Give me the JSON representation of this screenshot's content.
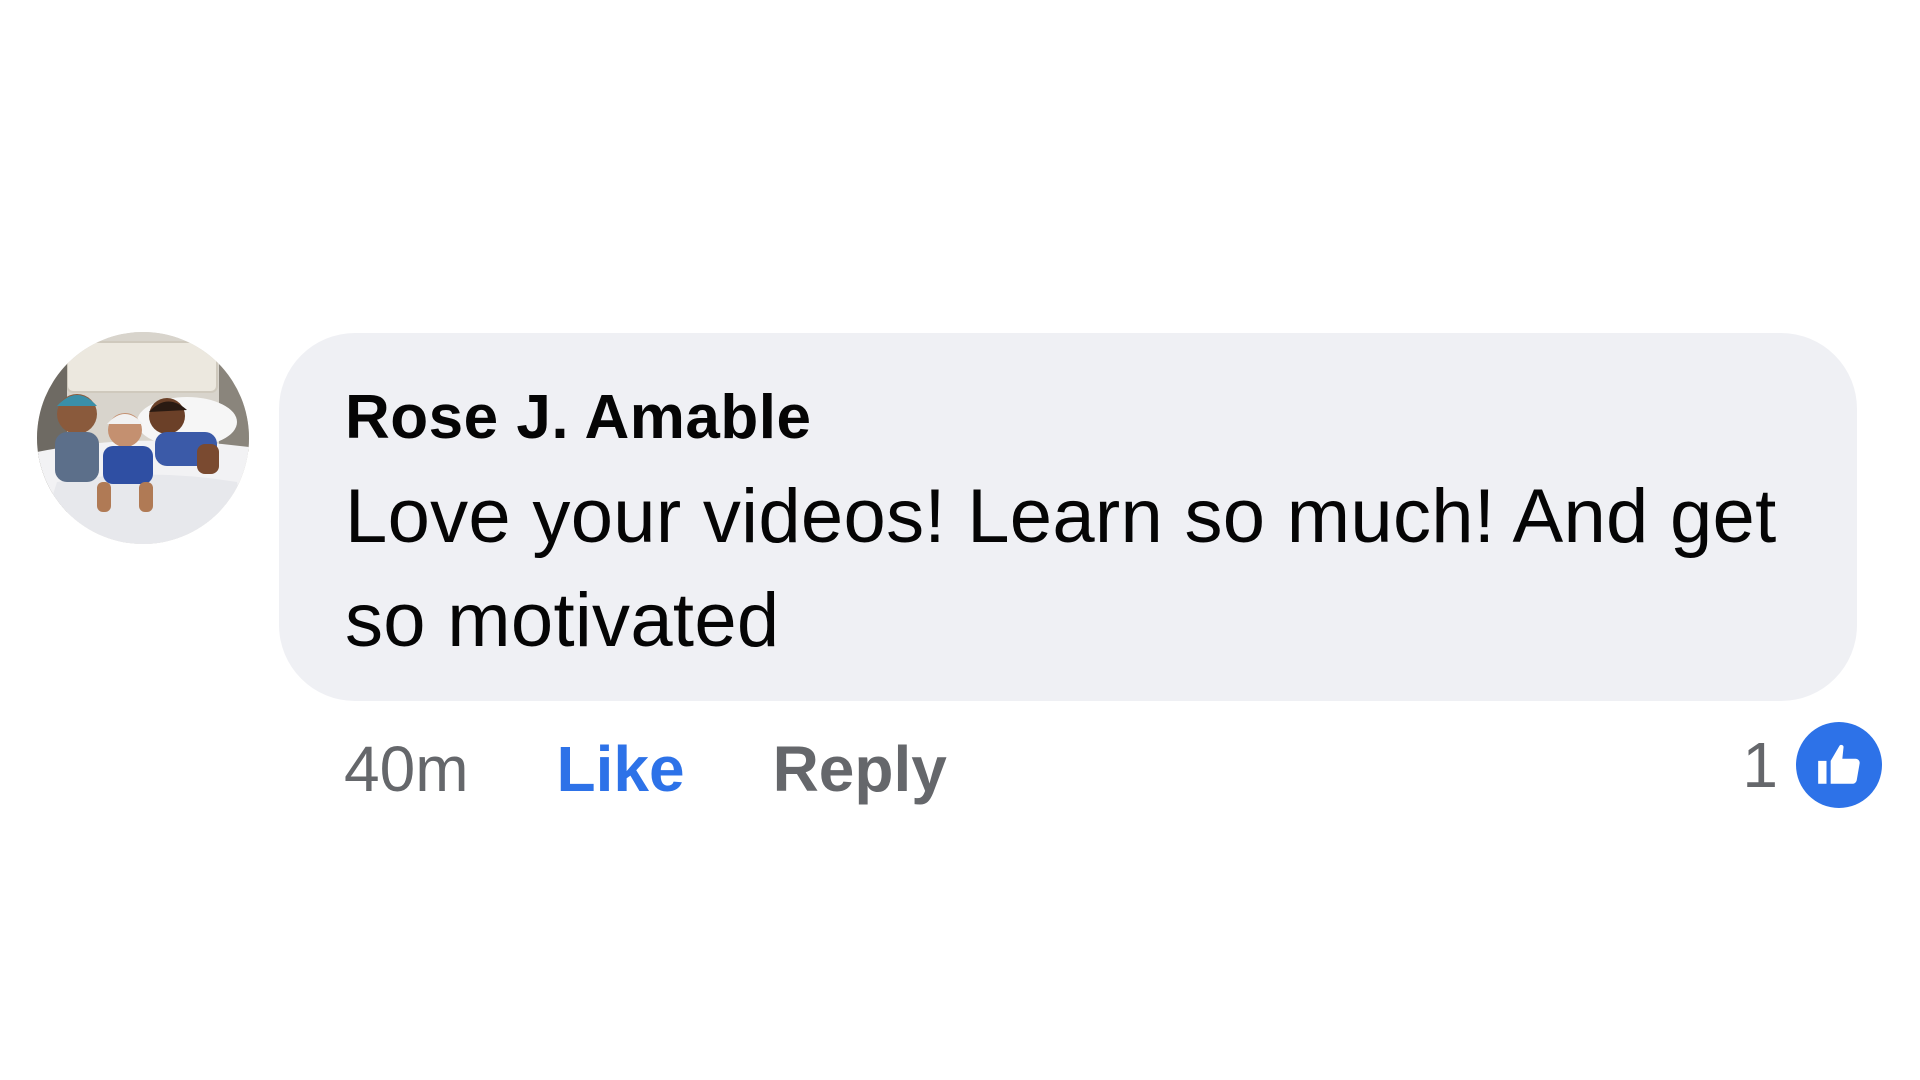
{
  "comment": {
    "author": "Rose J. Amable",
    "text": "Love your videos! Learn so much! And get so motivated",
    "avatar_icon": "profile-photo",
    "actions": {
      "time": "40m",
      "like_label": "Like",
      "reply_label": "Reply"
    },
    "reactions": {
      "count": "1",
      "icon": "thumbs-up-icon"
    }
  },
  "colors": {
    "bubble": "#eff0f4",
    "like_blue": "#2d72e8",
    "muted_text": "#65676b",
    "text": "#050505"
  }
}
